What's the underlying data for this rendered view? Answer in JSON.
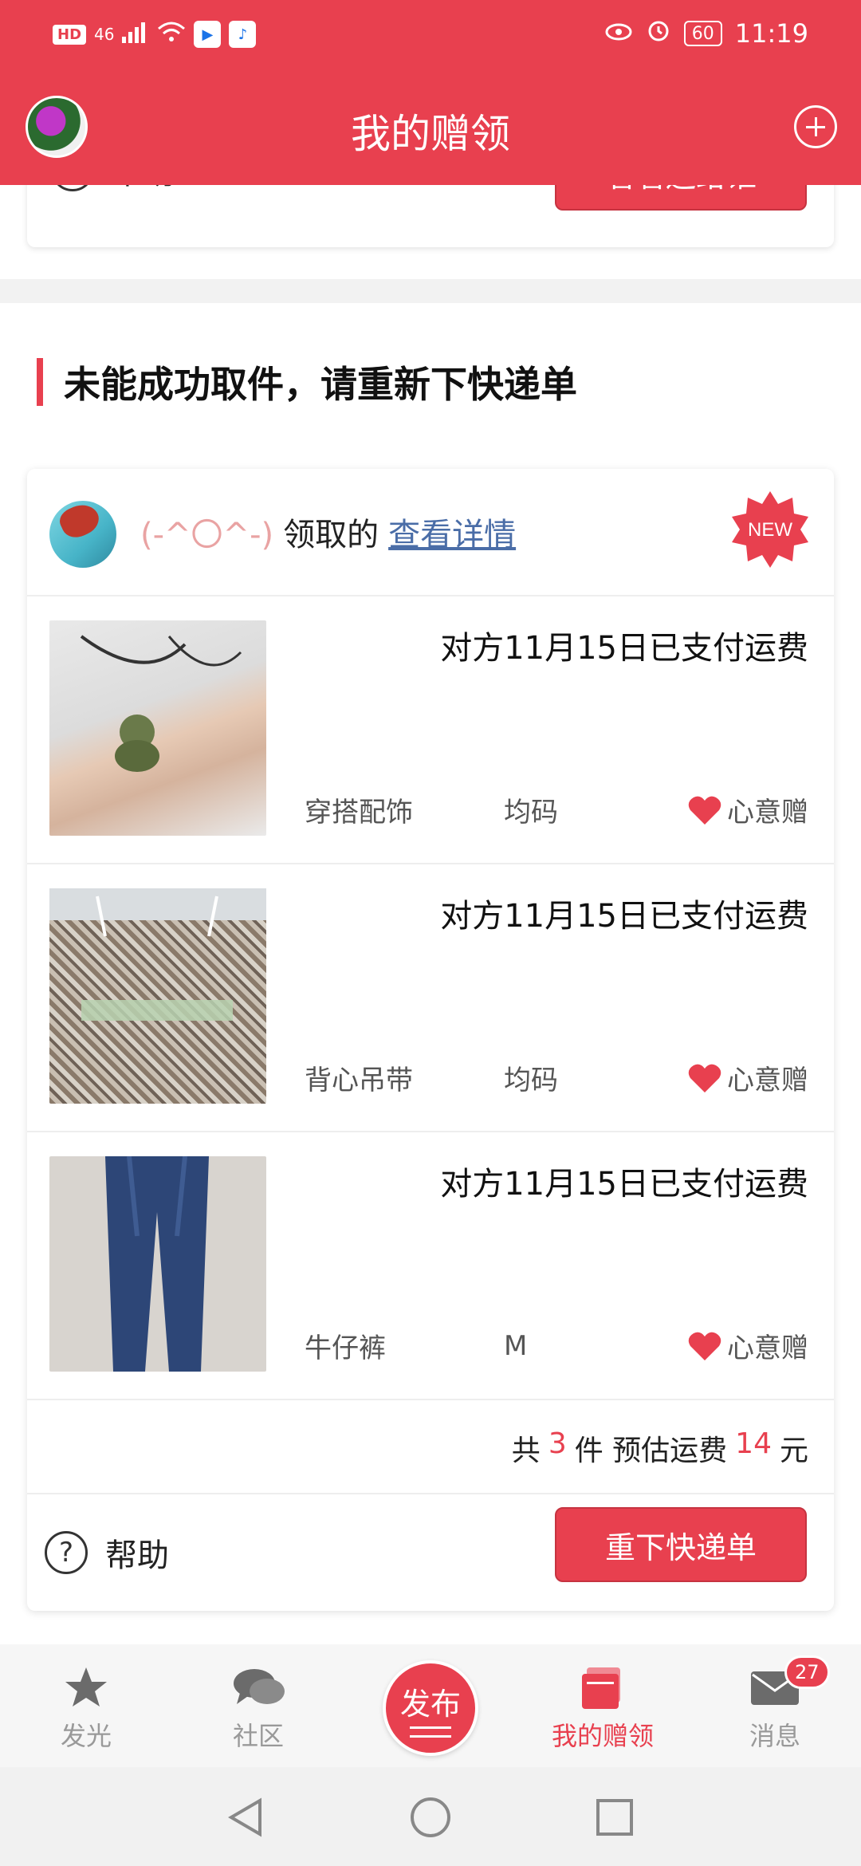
{
  "status_bar": {
    "hd": "HD",
    "signal": "46",
    "battery": "60",
    "time": "11:19"
  },
  "app_bar": {
    "title": "我的赠领"
  },
  "previous_card": {
    "help_label": "帮助",
    "button_label": "看看送给谁"
  },
  "section": {
    "title": "未能成功取件，请重新下快递单"
  },
  "card": {
    "nickname": "(-^〇^-)",
    "action_text": "领取的",
    "detail_link": "查看详情",
    "badge": "NEW",
    "items": [
      {
        "status": "对方11月15日已支付运费",
        "category": "穿搭配饰",
        "size": "均码",
        "gift_type": "心意赠"
      },
      {
        "status": "对方11月15日已支付运费",
        "category": "背心吊带",
        "size": "均码",
        "gift_type": "心意赠"
      },
      {
        "status": "对方11月15日已支付运费",
        "category": "牛仔裤",
        "size": "M",
        "gift_type": "心意赠"
      }
    ],
    "summary": {
      "prefix": "共",
      "count": "3",
      "count_unit": "件 预估运费",
      "fee": "14",
      "fee_unit": "元"
    },
    "help_label": "帮助",
    "reorder_button": "重下快递单"
  },
  "bottom_nav": {
    "items": [
      {
        "label": "发光",
        "icon": "star-icon"
      },
      {
        "label": "社区",
        "icon": "chat-bubbles-icon"
      },
      {
        "label": "发布",
        "icon": "publish-icon"
      },
      {
        "label": "我的赠领",
        "icon": "cards-icon"
      },
      {
        "label": "消息",
        "icon": "mail-icon"
      }
    ],
    "message_badge": "27"
  },
  "colors": {
    "accent": "#e8404f",
    "link": "#4a6da7",
    "nickname": "#e9a3a3"
  }
}
